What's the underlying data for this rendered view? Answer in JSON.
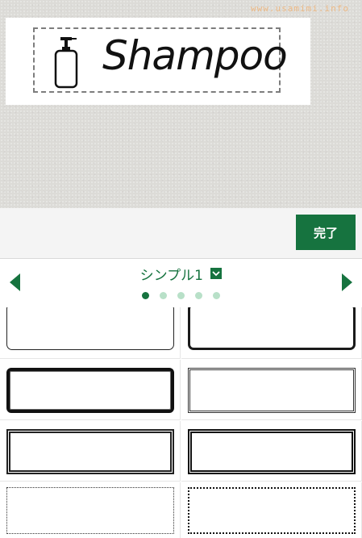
{
  "preview": {
    "watermark": "www.usamimi.info",
    "label_text": "Shampoo",
    "icon": "pump-bottle-icon"
  },
  "toolbar": {
    "done_label": "完了",
    "accent_color": "#16733f"
  },
  "selector": {
    "category": "シンプル1",
    "page_count": 5,
    "active_page": 1,
    "prev_icon": "triangle-left-icon",
    "next_icon": "triangle-right-icon",
    "dropdown_icon": "chevron-down-icon"
  },
  "frames": [
    {
      "style": "thin-rounded"
    },
    {
      "style": "thick-rounded"
    },
    {
      "style": "bold-rounded"
    },
    {
      "style": "double-thin"
    },
    {
      "style": "double-bold"
    },
    {
      "style": "double-bold"
    },
    {
      "style": "dotted"
    },
    {
      "style": "dotted-bold"
    }
  ]
}
